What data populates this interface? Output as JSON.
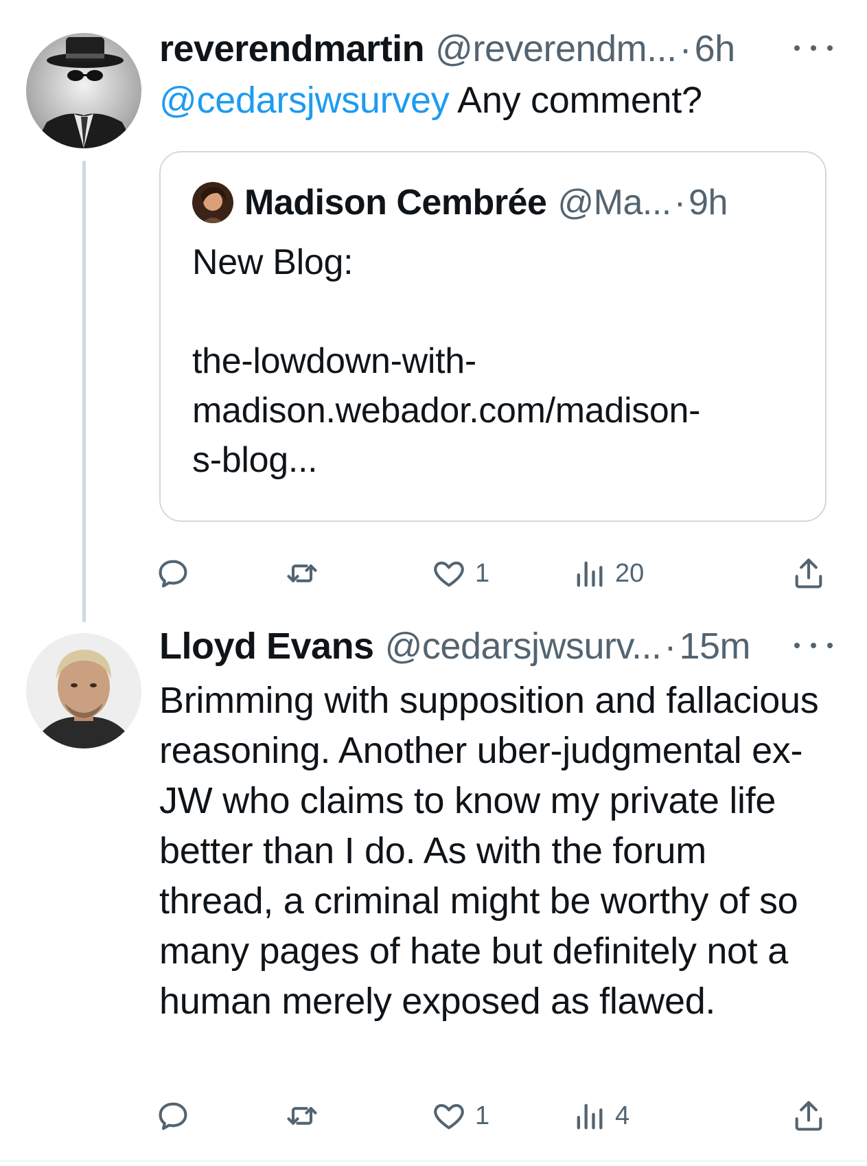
{
  "tweet1": {
    "display_name": "reverendmartin",
    "handle": "@reverendm...",
    "separator": "·",
    "time": "6h",
    "mention": "@cedarsjwsurvey",
    "text": " Any comment?",
    "quote": {
      "display_name": "Madison Cembrée",
      "handle": "@Ma...",
      "separator": "·",
      "time": "9h",
      "text": "New Blog:\n\nthe-lowdown-with-\nmadison.webador.com/madison-\ns-blog..."
    },
    "actions": {
      "likes": "1",
      "views": "20"
    }
  },
  "tweet2": {
    "display_name": "Lloyd Evans",
    "handle": "@cedarsjwsurv...",
    "separator": "·",
    "time": "15m",
    "text": "Brimming with supposition and fallacious reasoning. Another uber-judgmental ex-JW who claims to know my private life better than I do. As with the forum thread, a criminal might be worthy of so many pages of hate but definitely not a human merely exposed as flawed.",
    "actions": {
      "likes": "1",
      "views": "4"
    }
  },
  "colors": {
    "link": "#1d9bf0",
    "secondary_text": "#536471",
    "border": "#cfd9de"
  },
  "icons": [
    "reply-icon",
    "retweet-icon",
    "like-icon",
    "views-icon",
    "share-icon",
    "more-icon"
  ]
}
